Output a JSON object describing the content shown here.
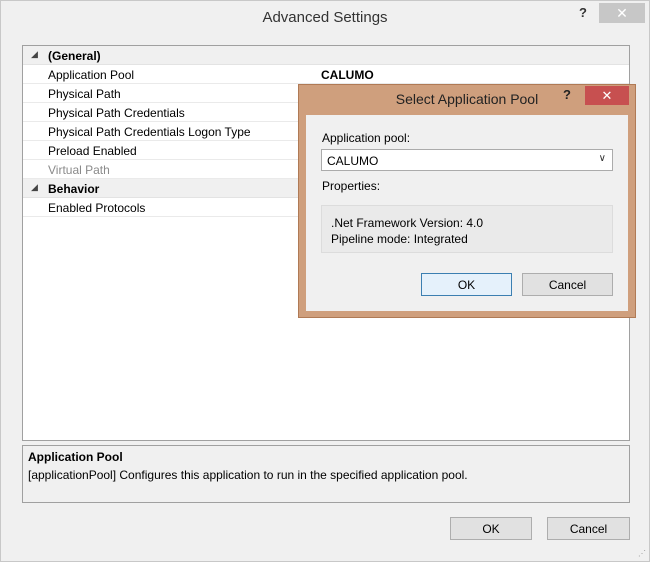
{
  "window": {
    "title": "Advanced Settings",
    "help_glyph": "?",
    "close_glyph": "✕"
  },
  "grid": {
    "categories": [
      {
        "label": "(General)",
        "expander": "◢"
      },
      {
        "label": "Behavior",
        "expander": "◢"
      }
    ],
    "rows": [
      {
        "name": "Application Pool",
        "value": "CALUMO"
      },
      {
        "name": "Physical Path",
        "value": ""
      },
      {
        "name": "Physical Path Credentials",
        "value": ""
      },
      {
        "name": "Physical Path Credentials Logon Type",
        "value": ""
      },
      {
        "name": "Preload Enabled",
        "value": ""
      },
      {
        "name": "Virtual Path",
        "value": ""
      },
      {
        "name": "Enabled Protocols",
        "value": ""
      }
    ]
  },
  "description": {
    "title": "Application Pool",
    "text": "[applicationPool] Configures this application to run in the specified application pool."
  },
  "buttons": {
    "ok": "OK",
    "cancel": "Cancel"
  },
  "dialog": {
    "title": "Select Application Pool",
    "help_glyph": "?",
    "close_glyph": "✕",
    "pool_label": "Application pool:",
    "pool_value": "CALUMO",
    "properties_label": "Properties:",
    "framework": ".Net Framework Version: 4.0",
    "pipeline": "Pipeline mode: Integrated",
    "ok": "OK",
    "cancel": "Cancel",
    "close_color": "#c75050"
  }
}
